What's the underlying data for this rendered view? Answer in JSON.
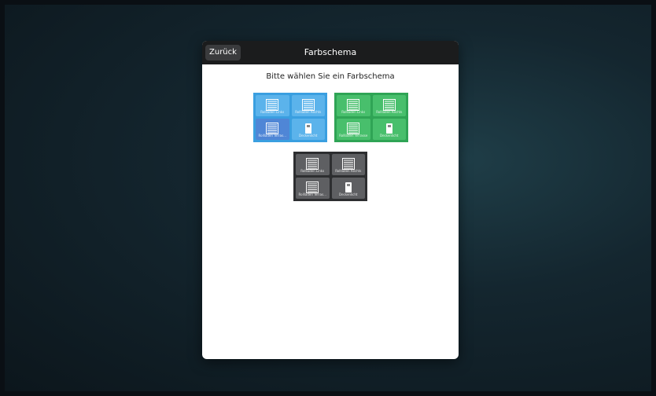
{
  "dialog": {
    "back_label": "Zurück",
    "title": "Farbschema",
    "prompt": "Bitte wählen Sie ein Farbschema"
  },
  "schemes": [
    {
      "name": "blue",
      "tiles": [
        {
          "label": "Rollladen Links",
          "icon": "blinds-icon"
        },
        {
          "label": "Rollladen Rechts",
          "icon": "blinds-icon"
        },
        {
          "label": "Rollladen Terras...",
          "icon": "blinds-icon"
        },
        {
          "label": "Deckenlicht",
          "icon": "light-switch-icon"
        }
      ]
    },
    {
      "name": "green",
      "tiles": [
        {
          "label": "Rollladen Links",
          "icon": "blinds-icon"
        },
        {
          "label": "Rollladen Rechts",
          "icon": "blinds-icon"
        },
        {
          "label": "Rollladen Terrasse",
          "icon": "blinds-icon"
        },
        {
          "label": "Deckenlicht",
          "icon": "light-switch-icon"
        }
      ]
    },
    {
      "name": "gray",
      "tiles": [
        {
          "label": "Rollladen Links",
          "icon": "blinds-icon"
        },
        {
          "label": "Rollladen Rechts",
          "icon": "blinds-icon"
        },
        {
          "label": "Rollladen Terras...",
          "icon": "blinds-icon"
        },
        {
          "label": "Deckenlicht",
          "icon": "light-switch-icon"
        }
      ]
    }
  ],
  "colors": {
    "blue": "#3a9fe0",
    "green": "#2fa455",
    "gray": "#2d2e30",
    "titlebar": "#1b1c1d"
  }
}
